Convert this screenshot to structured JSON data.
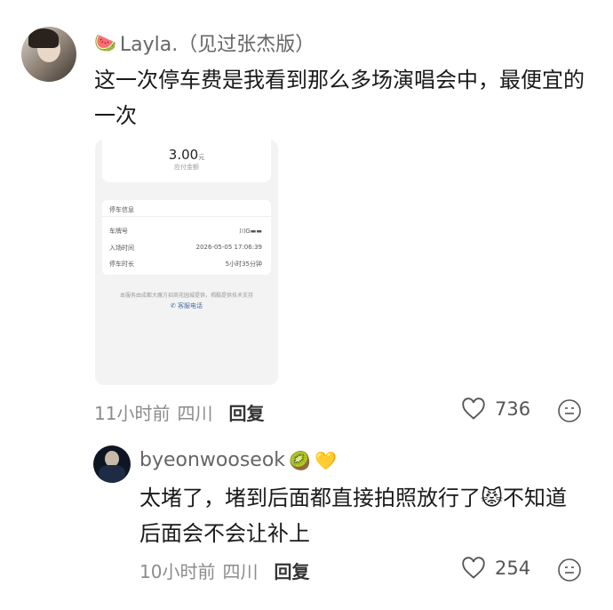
{
  "comment1": {
    "username": "Layla.（见过张杰版）",
    "text_line1": "这一次停车费是我看到那么多场演唱会中，最便宜的",
    "text_line2": "一次",
    "time": "11小时前",
    "location": "四川",
    "reply_label": "回复",
    "likes": "736",
    "image": {
      "amount": "3.00",
      "amount_unit": "元",
      "amount_label": "应付金额",
      "section_title": "停车信息",
      "rows": [
        {
          "label": "车牌号",
          "value": "川G▬▬"
        },
        {
          "label": "入场时间",
          "value": "2026-05-05 17:06:39"
        },
        {
          "label": "停车时长",
          "value": "5小时35分钟"
        }
      ],
      "footer_note": "本服务由成都大魔方招商花园城提供，揭酷提供技术支持",
      "service_phone": "客服电话"
    }
  },
  "comment2": {
    "username": "byeonwooseok",
    "text_line1": "太堵了，堵到后面都直接拍照放行了",
    "text_line1b": "不知道",
    "text_line2": "后面会不会让补上",
    "time": "10小时前",
    "location": "四川",
    "reply_label": "回复",
    "likes": "254"
  },
  "colors": {
    "meta_gray": "#8c8c8c",
    "heart": "#555555",
    "text": "#1a1a1a"
  }
}
